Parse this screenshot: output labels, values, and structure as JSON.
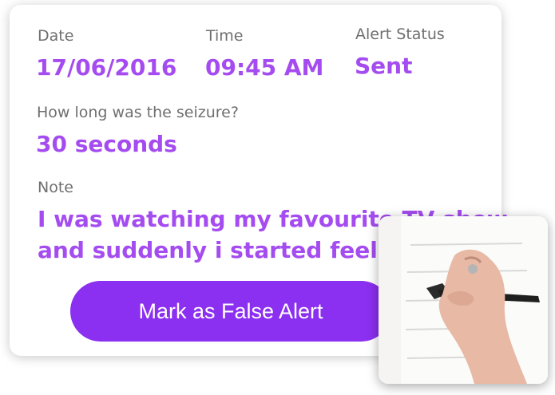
{
  "details": {
    "date_label": "Date",
    "date_value": "17/06/2016",
    "time_label": "Time",
    "time_value": "09:45 AM",
    "status_label": "Alert Status",
    "status_value": "Sent"
  },
  "seizure": {
    "question": "How long was the seizure?",
    "answer": "30 seconds"
  },
  "note": {
    "label": "Note",
    "line1": "I was watching my favourite TV show",
    "line2": "and suddenly i started feeling..."
  },
  "actions": {
    "false_alert_label": "Mark as False Alert"
  },
  "colors": {
    "accent": "#a54cf0",
    "button": "#8b2ff0",
    "label_gray": "#6f6f6f"
  },
  "icons": {
    "photo": "hand-writing-on-paper"
  }
}
